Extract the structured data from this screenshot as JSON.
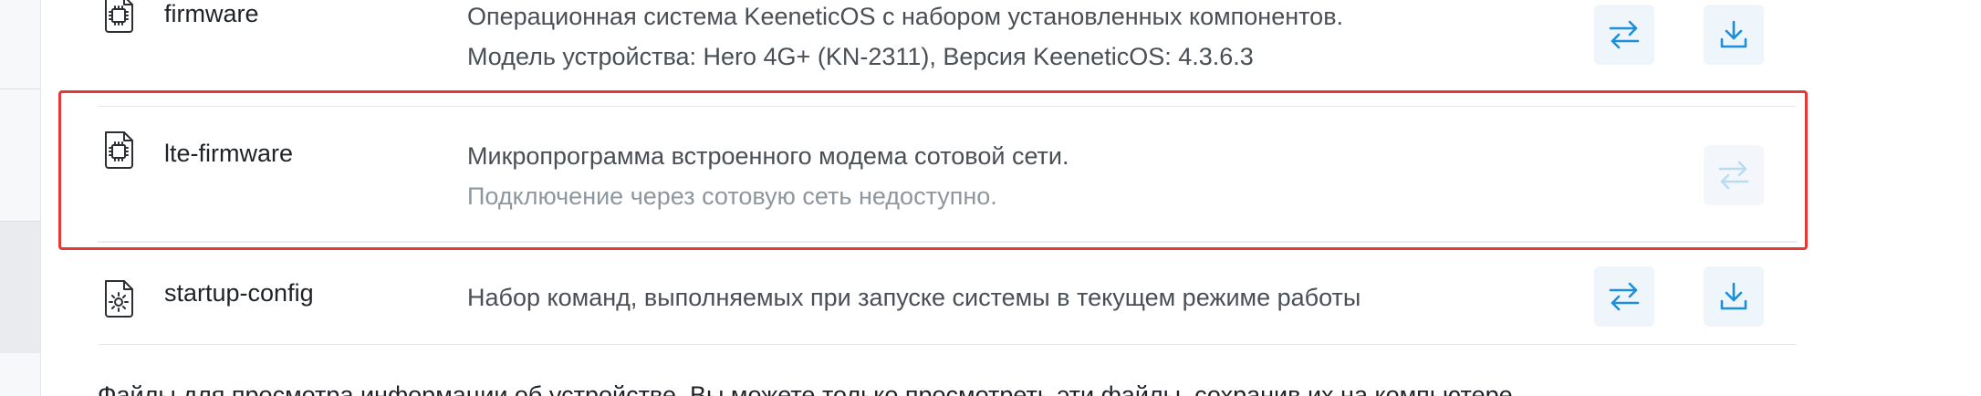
{
  "files": [
    {
      "name": "firmware",
      "icon": "chip-file-icon",
      "desc_line1": "Операционная система KeeneticOS с набором установленных компонентов.",
      "desc_line2": "Модель устройства: Hero 4G+ (KN-2311), Версия KeeneticOS: 4.3.6.3",
      "swap_enabled": true,
      "download_enabled": true
    },
    {
      "name": "lte-firmware",
      "icon": "chip-file-icon",
      "desc_line1": "Микропрограмма встроенного модема сотовой сети.",
      "desc_line2": "Подключение через сотовую сеть недоступно.",
      "swap_enabled": false,
      "download_enabled": false
    },
    {
      "name": "startup-config",
      "icon": "gear-file-icon",
      "desc_line1": "Набор команд, выполняемых при запуске системы в текущем режиме работы",
      "desc_line2": "",
      "swap_enabled": true,
      "download_enabled": true
    }
  ],
  "footer": {
    "text": "Файлы для просмотра информации об устройстве. Вы можете только просмотреть эти файлы, сохранив их на компьютере."
  },
  "colors": {
    "accent": "#1d8fd8",
    "accent_disabled": "#b9dcf2",
    "highlight": "#e53935"
  }
}
